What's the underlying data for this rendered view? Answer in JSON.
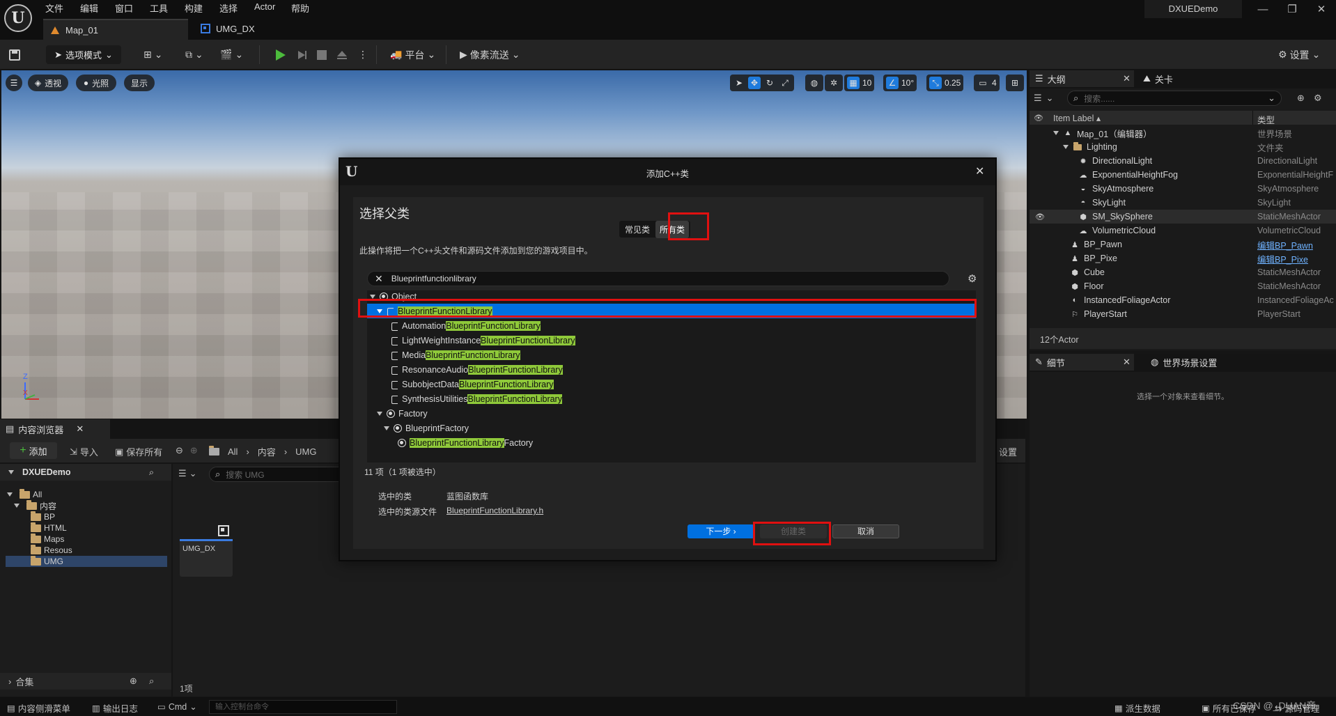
{
  "menu": [
    "文件",
    "编辑",
    "窗口",
    "工具",
    "构建",
    "选择",
    "Actor",
    "帮助"
  ],
  "tabs": [
    "Map_01",
    "UMG_DX"
  ],
  "project": "DXUEDemo",
  "window_controls": {
    "minimize": "—",
    "maximize": "❐",
    "close": "✕"
  },
  "toolbar": {
    "mode_label": "选项模式",
    "platform_label": "平台",
    "streaming_label": "像素流送",
    "settings_label": "设置"
  },
  "viewport": {
    "perspective": "透视",
    "lighting": "光照",
    "show": "显示",
    "grid_snap": "10",
    "rot_snap": "10°",
    "scale_snap": "0.25",
    "camera_speed": "4",
    "axis_z": "Z",
    "axis_x": "X"
  },
  "outliner": {
    "tab_outliner": "大纲",
    "tab_levels": "关卡",
    "search_placeholder": "搜索......",
    "col_label": "Item Label ▴",
    "col_type": "类型",
    "rows": [
      {
        "label": "Map_01（编辑器）",
        "type": "世界场景"
      },
      {
        "label": "Lighting",
        "type": "文件夹"
      },
      {
        "label": "DirectionalLight",
        "type": "DirectionalLight"
      },
      {
        "label": "ExponentialHeightFog",
        "type": "ExponentialHeightF"
      },
      {
        "label": "SkyAtmosphere",
        "type": "SkyAtmosphere"
      },
      {
        "label": "SkyLight",
        "type": "SkyLight"
      },
      {
        "label": "SM_SkySphere",
        "type": "StaticMeshActor"
      },
      {
        "label": "VolumetricCloud",
        "type": "VolumetricCloud"
      },
      {
        "label": "BP_Pawn",
        "type": "编辑BP_Pawn"
      },
      {
        "label": "BP_Pixe",
        "type": "编辑BP_Pixe"
      },
      {
        "label": "Cube",
        "type": "StaticMeshActor"
      },
      {
        "label": "Floor",
        "type": "StaticMeshActor"
      },
      {
        "label": "InstancedFoliageActor",
        "type": "InstancedFoliageAc"
      },
      {
        "label": "PlayerStart",
        "type": "PlayerStart"
      }
    ],
    "actor_count": "12个Actor"
  },
  "details": {
    "tab_details": "细节",
    "tab_world": "世界场景设置",
    "empty_msg": "选择一个对象来查看细节。"
  },
  "content_browser": {
    "tab": "内容浏览器",
    "add": "添加",
    "import": "导入",
    "save_all": "保存所有",
    "crumb_all": "All",
    "crumb_content": "内容",
    "crumb_umg": "UMG",
    "settings": "设置",
    "root": "DXUEDemo",
    "search_placeholder": "搜索 UMG",
    "tree": [
      "All",
      "内容",
      "BP",
      "HTML",
      "Maps",
      "Resous",
      "UMG"
    ],
    "asset_name": "UMG_DX",
    "item_count": "1项",
    "collections": "合集"
  },
  "statusbar": {
    "drawer": "内容侧滑菜单",
    "output_log": "输出日志",
    "cmd": "Cmd",
    "console_placeholder": "输入控制台命令",
    "derived_data": "派生数据",
    "all_saved": "所有已保存",
    "source_control": "源码管理",
    "watermark": "CSDN @_DUAN帝"
  },
  "dialog": {
    "title": "添加C++类",
    "heading": "选择父类",
    "tab_common": "常见类",
    "tab_all": "所有类",
    "description": "此操作将把一个C++头文件和源码文件添加到您的游戏项目中。",
    "search_value": "Blueprintfunctionlibrary",
    "tree_object": "Object",
    "tree_selected": "BlueprintFunctionLibrary",
    "tree_highlight": "BlueprintFunctionLibrary",
    "children": [
      "Automation",
      "LightWeightInstance",
      "Media",
      "ResonanceAudio",
      "SubobjectData",
      "SynthesisUtilities"
    ],
    "tree_factory": "Factory",
    "tree_bp_factory": "BlueprintFactory",
    "tree_factory_suffix": "Factory",
    "count": "11 项（1 项被选中）",
    "selected_class_label": "选中的类",
    "selected_class_value": "蓝图函数库",
    "selected_file_label": "选中的类源文件",
    "selected_file_value": "BlueprintFunctionLibrary.h",
    "btn_next": "下一步 ›",
    "btn_create": "创建类",
    "btn_cancel": "取消"
  },
  "colors": {
    "accent": "#0070e0",
    "highlight": "#8fc93a",
    "annotation": "#e01010",
    "panel": "#1a1a1a"
  }
}
